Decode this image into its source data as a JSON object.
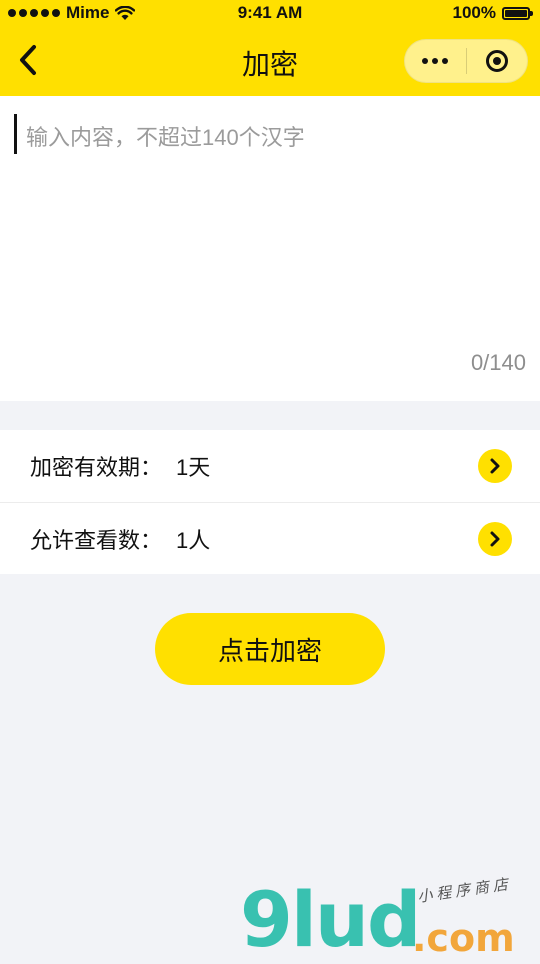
{
  "status_bar": {
    "carrier": "Mime",
    "time": "9:41 AM",
    "battery_text": "100%"
  },
  "nav": {
    "title": "加密"
  },
  "text_area": {
    "placeholder": "输入内容，不超过140个汉字",
    "value": "",
    "char_count": "0/140"
  },
  "options": [
    {
      "label": "加密有效期：",
      "value": "1天"
    },
    {
      "label": "允许查看数：",
      "value": "1人"
    }
  ],
  "actions": {
    "encrypt_label": "点击加密"
  },
  "watermark": {
    "logo": "9lud",
    "domain": ".com",
    "subtitle": "小程序商店"
  },
  "colors": {
    "accent": "#ffe000",
    "background": "#f2f3f7",
    "logo_teal": "#39c1b0",
    "logo_orange": "#f2a63b"
  }
}
